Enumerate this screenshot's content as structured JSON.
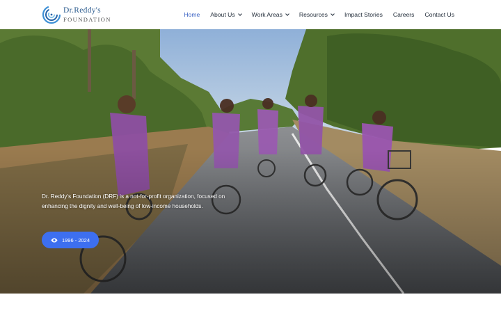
{
  "brand": {
    "name_line1": "Dr.Reddy's",
    "name_line2": "FOUNDATION"
  },
  "nav": {
    "items": [
      {
        "label": "Home",
        "active": true
      },
      {
        "label": "About Us",
        "dropdown": true
      },
      {
        "label": "Work Areas",
        "dropdown": true
      },
      {
        "label": "Resources",
        "dropdown": true
      },
      {
        "label": "Impact Stories"
      },
      {
        "label": "Careers"
      },
      {
        "label": "Contact Us"
      }
    ]
  },
  "hero": {
    "description": "Dr. Reddy's Foundation (DRF) is a not-for-profit organization, focused on enhancing the dignity and well-being of low-income households.",
    "button_label": "1996 - 2024",
    "button_icon": "eye-icon"
  },
  "colors": {
    "accent": "#3d6ff0",
    "nav_active": "#3b63c4",
    "brand_blue": "#2b5b8e"
  }
}
